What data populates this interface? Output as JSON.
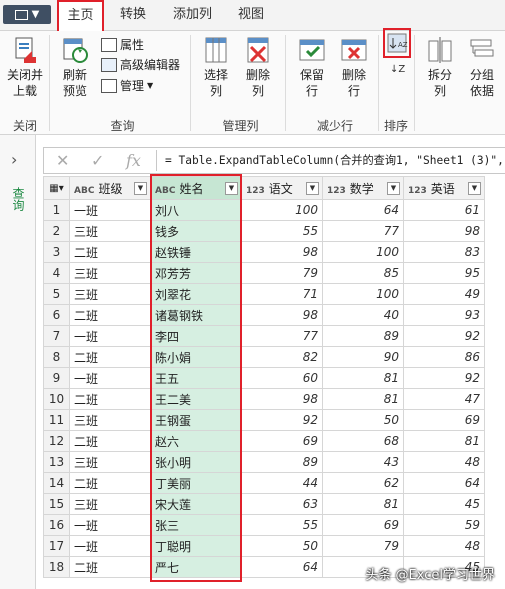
{
  "tabs": [
    {
      "label": "主页",
      "active": true
    },
    {
      "label": "转换",
      "active": false
    },
    {
      "label": "添加列",
      "active": false
    },
    {
      "label": "视图",
      "active": false
    }
  ],
  "ribbon": {
    "close_load": "关闭并\n上载",
    "refresh_preview": "刷新\n预览",
    "properties": "属性",
    "advanced_editor": "高级编辑器",
    "manage": "管理",
    "choose_columns": "选择\n列",
    "remove_columns": "删除\n列",
    "keep_rows": "保留\n行",
    "remove_rows": "删除\n行",
    "split_column": "拆分\n列",
    "group_by": "分组\n依据",
    "groups": {
      "close": "关闭",
      "query": "查询",
      "manage_columns": "管理列",
      "reduce_rows": "减少行",
      "sort": "排序"
    }
  },
  "left_pane": {
    "label": "查询"
  },
  "formula_bar": {
    "cancel": "✕",
    "confirm": "✓",
    "fx": "fx",
    "text": "= Table.ExpandTableColumn(合并的查询1, \"Sheet1 (3)\","
  },
  "table": {
    "columns": [
      {
        "type": "ABC",
        "name": "班级"
      },
      {
        "type": "ABC",
        "name": "姓名"
      },
      {
        "type": "123",
        "name": "语文"
      },
      {
        "type": "123",
        "name": "数学"
      },
      {
        "type": "123",
        "name": "英语"
      }
    ],
    "rows": [
      [
        "一班",
        "刘八",
        "100",
        "64",
        "61"
      ],
      [
        "三班",
        "钱多",
        "55",
        "77",
        "98"
      ],
      [
        "二班",
        "赵铁锤",
        "98",
        "100",
        "83"
      ],
      [
        "三班",
        "邓芳芳",
        "79",
        "85",
        "95"
      ],
      [
        "三班",
        "刘翠花",
        "71",
        "100",
        "49"
      ],
      [
        "二班",
        "诸葛钢铁",
        "98",
        "40",
        "93"
      ],
      [
        "一班",
        "李四",
        "77",
        "89",
        "92"
      ],
      [
        "二班",
        "陈小娟",
        "82",
        "90",
        "86"
      ],
      [
        "一班",
        "王五",
        "60",
        "81",
        "92"
      ],
      [
        "二班",
        "王二美",
        "98",
        "81",
        "47"
      ],
      [
        "三班",
        "王钢蛋",
        "92",
        "50",
        "69"
      ],
      [
        "二班",
        "赵六",
        "69",
        "68",
        "81"
      ],
      [
        "三班",
        "张小明",
        "89",
        "43",
        "48"
      ],
      [
        "二班",
        "丁美丽",
        "44",
        "62",
        "64"
      ],
      [
        "三班",
        "宋大莲",
        "63",
        "81",
        "45"
      ],
      [
        "一班",
        "张三",
        "55",
        "69",
        "59"
      ],
      [
        "一班",
        "丁聪明",
        "50",
        "79",
        "48"
      ],
      [
        "二班",
        "严七",
        "64",
        "",
        "45"
      ]
    ]
  },
  "watermark": "头条 @Excel学习世界",
  "colors": {
    "highlight": "#e0202a",
    "selected_col": "#d6efe1",
    "accent_green": "#1e8a44"
  }
}
